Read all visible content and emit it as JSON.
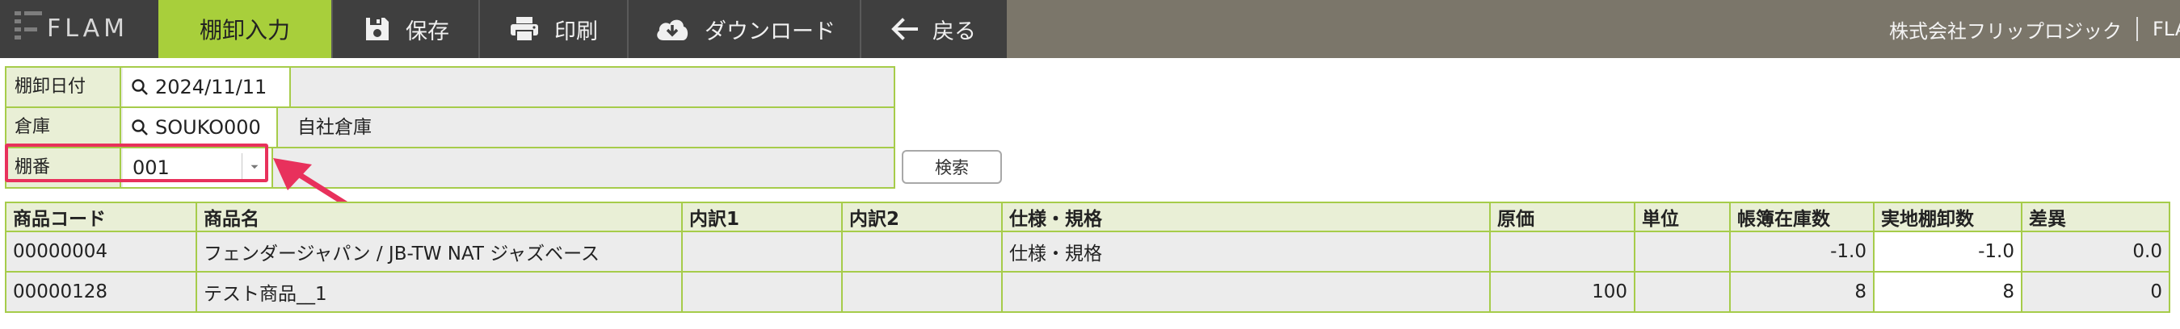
{
  "header": {
    "logo_text": "FLAM",
    "active_tab": "棚卸入力",
    "buttons": {
      "save": "保存",
      "print": "印刷",
      "download": "ダウンロード",
      "back": "戻る"
    },
    "company": "株式会社フリップロジック",
    "company_extra": "FLA"
  },
  "filters": {
    "date_label": "棚卸日付",
    "date_value": "2024/11/11",
    "warehouse_label": "倉庫",
    "warehouse_code": "SOUKO000",
    "warehouse_name": "自社倉庫",
    "rack_label": "棚番",
    "rack_value": "001",
    "search_button": "検索"
  },
  "table": {
    "columns": [
      "商品コード",
      "商品名",
      "内訳1",
      "内訳2",
      "仕様・規格",
      "原価",
      "単位",
      "帳簿在庫数",
      "実地棚卸数",
      "差異"
    ],
    "rows": [
      [
        "00000004",
        "フェンダージャパン / JB-TW NAT ジャズベース",
        "",
        "",
        "仕様・規格",
        "",
        "",
        "-1.0",
        "-1.0",
        "0.0"
      ],
      [
        "00000128",
        "テスト商品__1",
        "",
        "",
        "",
        "100",
        "",
        "8",
        "8",
        "0"
      ]
    ]
  },
  "colors": {
    "accent": "#a8cf3b",
    "topbar": "#7b766a",
    "toolbar": "#3f3f3f",
    "highlight": "#e8315c"
  }
}
